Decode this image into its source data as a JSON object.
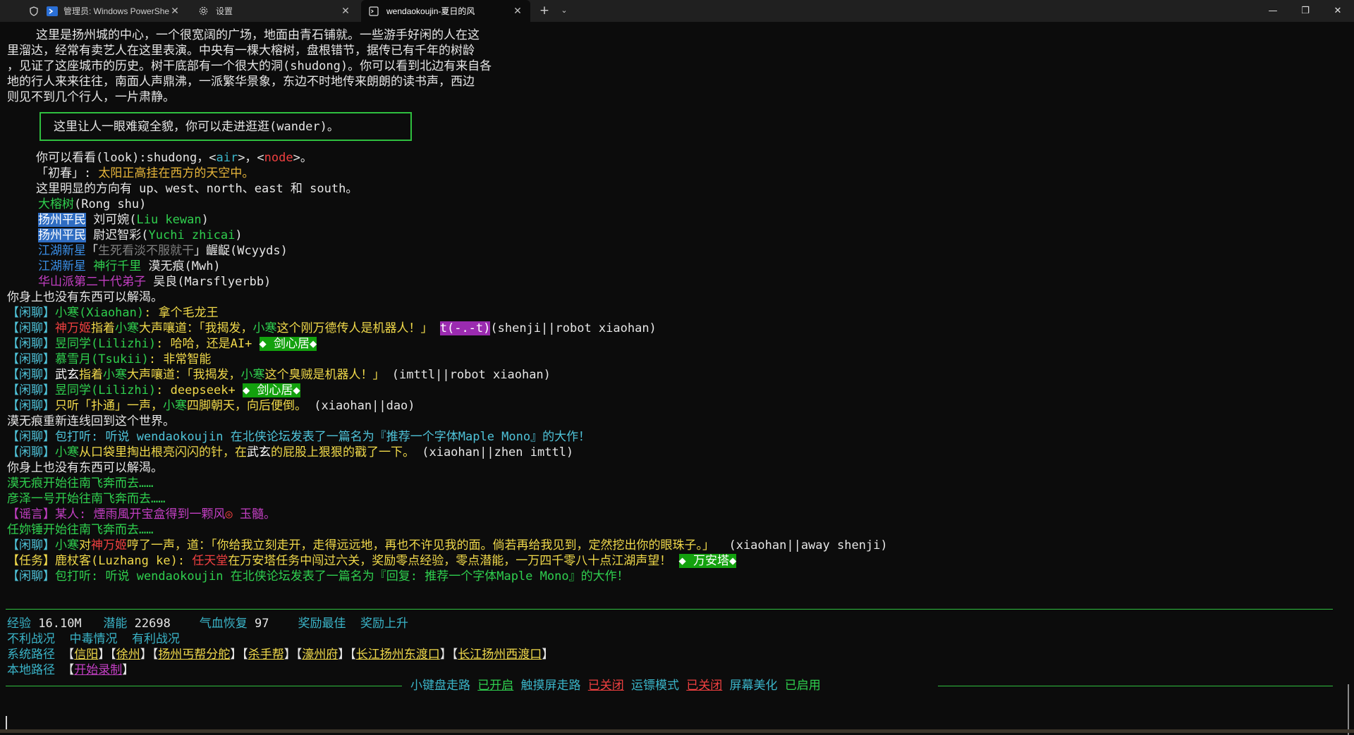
{
  "window": {
    "tabs": [
      {
        "label": "管理员: Windows PowerShell",
        "icon": "shield-icon",
        "active": false
      },
      {
        "label": "设置",
        "icon": "gear-icon",
        "active": false
      },
      {
        "label": "wendaokoujin-夏日的风",
        "icon": "terminal-icon",
        "active": true
      }
    ],
    "new_tab": "+",
    "tab_dropdown": "⌄",
    "controls": {
      "minimize": "—",
      "maximize": "❐",
      "close": "✕"
    }
  },
  "room": {
    "desc": [
      "    这里是扬州城的中心，一个很宽阔的广场，地面由青石铺就。一些游手好闲的人在这",
      "里溜达，经常有卖艺人在这里表演。中央有一棵大榕树，盘根错节，据传已有千年的树龄",
      "，见证了这座城市的历史。树干底部有一个很大的洞(shudong)。你可以看到北边有来自各",
      "地的行人来来往往，南面人声鼎沸，一派繁华景象，东边不时地传来朗朗的读书声，西边",
      "则见不到几个行人，一片肃静。"
    ],
    "notice": "这里让人一眼难窥全貌，你可以走进逛逛(wander)。",
    "look": {
      "prefix": "    你可以看看(look):shudong，<",
      "air": "air",
      "mid": ">，<",
      "node": "node",
      "suffix": ">。"
    },
    "season": {
      "tag": "    「初春」: ",
      "text": "太阳正高挂在西方的天空中。"
    },
    "exits": "    这里明显的方向有 up、west、north、east 和 south。",
    "objects": {
      "name": "大榕树",
      "pinyin": "(Rong shu)"
    },
    "npcs": [
      {
        "title": "扬州平民",
        "name": " 刘可婉(",
        "pinyin": "Liu kewan",
        "close": ")"
      },
      {
        "title": "扬州平民",
        "name": " 尉迟智彩(",
        "pinyin": "Yuchi zhicai",
        "close": ")"
      }
    ],
    "players": [
      {
        "title1": "江湖新星",
        "open": "「",
        "nick": "生死看淡不服就干",
        "close": "」",
        "name": "齷齪(Wcyyds)"
      },
      {
        "title1": "江湖新星",
        "title2": "神行千里",
        "name": " 漠无痕(Mwh)"
      },
      {
        "title1": "华山派第二十代弟子",
        "name": " 吴良(Marsflyerbb)"
      }
    ]
  },
  "messages": {
    "drink1": "你身上也没有东西可以解渴。",
    "chat_tag": "【闲聊】",
    "c1": {
      "name": "小寒(Xiaohan)",
      "text": ": 拿个毛龙王"
    },
    "c2": {
      "actor": "神万姬",
      "act1": "指着",
      "target": "小寒",
      "act2": "大声嚷道：「我揭发，",
      "target2": "小寒",
      "act3": "这个刚万德传人是机器人！」 ",
      "emote": "t(-.-t)",
      "cmd": "(shenji||robot xiaohan)"
    },
    "c3": {
      "name": "昱同学(Lilizhi)",
      "text": ": 哈哈，还是AI+ ",
      "badge": "◆ 剑心居◆"
    },
    "c4": {
      "name": "慕雪月(Tsukii)",
      "text": ": 非常智能"
    },
    "c5": {
      "actor": "武玄",
      "act1": "指着",
      "target": "小寒",
      "act2": "大声嚷道：「我揭发，",
      "target2": "小寒",
      "act3": "这个臭贼是机器人！」",
      "cmd": " (imttl||robot xiaohan)"
    },
    "c6": {
      "name": "昱同学(Lilizhi)",
      "text": ": deepseek+ ",
      "badge": "◆ 剑心居◆"
    },
    "c7": {
      "pre": "只听「扑通」一声，",
      "target": "小寒",
      "post": "四脚朝天，向后便倒。",
      "cmd": " (xiaohan||dao)"
    },
    "reconnect": "漠无痕重新连线回到这个世界。",
    "c8": {
      "text": "包打听: 听说 wendaokoujin 在北侠论坛发表了一篇名为『推荐一个字体Maple Mono』的大作！"
    },
    "c9": {
      "actor": "小寒",
      "pre": "从口袋里掏出根亮闪闪的针，在",
      "target": "武玄",
      "post": "的屁股上狠狠的戳了一下。",
      "cmd": " (xiaohan||zhen imttl)"
    },
    "drink2": "你身上也没有东西可以解渴。",
    "move1": "漠无痕开始往南飞奔而去……",
    "move2": "彦泽一号开始往南飞奔而去……",
    "rumor": {
      "tag": "【谣言】",
      "text": "某人: 煙雨風开宝盒得到一颗风",
      "gem": "◎",
      "text2": " 玉髓。"
    },
    "move3": "任妳锤开始往南飞奔而去……",
    "c10": {
      "actor": "小寒",
      "pre": "对",
      "target": "神万姬",
      "post": "哼了一声，道：「你给我立刻走开，走得远远地，再也不许见我的面。倘若再给我见到，定然挖出你的眼珠子。」",
      "cmd": "  (xiaohan||away shenji)"
    },
    "task": {
      "tag": "【任务】",
      "name": "鹿杖客(Luzhang ke)",
      "colon": ": ",
      "who": "任天堂",
      "text": "在万安塔任务中闯过六关，奖励零点经验，零点潜能，一万四千零八十点江湖声望！ ",
      "badge": "◆ 万安塔◆"
    },
    "c11": {
      "text": "包打听: 听说 wendaokoujin 在北侠论坛发表了一篇名为『回复: 推荐一个字体Maple Mono』的大作！"
    }
  },
  "status": {
    "exp_label": "经验",
    "exp_value": "16.10M",
    "pot_label": "潜能",
    "pot_value": "22698",
    "hp_label": "气血恢复",
    "hp_value": "97",
    "reward_best": "奖励最佳",
    "reward_up": "奖励上升",
    "bad_state": "不利战况",
    "poison": "中毒情况",
    "good_state": "有利战况",
    "sys_path_label": "系统路径",
    "sys_paths": [
      "信阳",
      "徐州",
      "扬州丐帮分舵",
      "杀手帮",
      "濠州府",
      "长江扬州东渡口",
      "长江扬州西渡口"
    ],
    "local_path_label": "本地路径",
    "local_path": "开始录制"
  },
  "toolbar": {
    "keypad_label": "小键盘走路",
    "keypad_state": "已开启",
    "touch_label": "触摸屏走路",
    "touch_state": "已关闭",
    "escort_label": "运镖模式",
    "escort_state": "已关闭",
    "beautify_label": "屏幕美化",
    "beautify_state": "已启用"
  }
}
